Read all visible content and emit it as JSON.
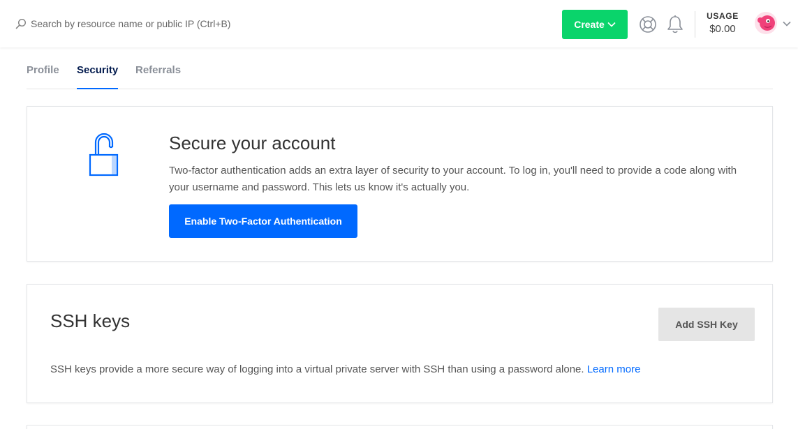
{
  "header": {
    "search": {
      "placeholder": "Search by resource name or public IP (Ctrl+B)",
      "value": ""
    },
    "create_label": "Create",
    "usage": {
      "label": "USAGE",
      "value": "$0.00"
    },
    "icons": [
      "search-icon",
      "chevron-down-icon",
      "help-icon",
      "bell-icon",
      "avatar",
      "chevron-down-icon"
    ]
  },
  "tabs": [
    {
      "label": "Profile",
      "active": false
    },
    {
      "label": "Security",
      "active": true
    },
    {
      "label": "Referrals",
      "active": false
    }
  ],
  "twofa": {
    "title": "Secure your account",
    "description": "Two-factor authentication adds an extra layer of security to your account. To log in, you'll need to provide a code along with your username and password. This lets us know it's actually you.",
    "button_label": "Enable Two-Factor Authentication",
    "icon": "unlocked-padlock-icon"
  },
  "ssh": {
    "title": "SSH keys",
    "button_label": "Add SSH Key",
    "description": "SSH keys provide a more secure way of logging into a virtual private server with SSH than using a password alone.",
    "link_label": "Learn more"
  },
  "colors": {
    "create": "#0ad46b",
    "primary": "#0069ff",
    "avatar": "#f0417a"
  }
}
